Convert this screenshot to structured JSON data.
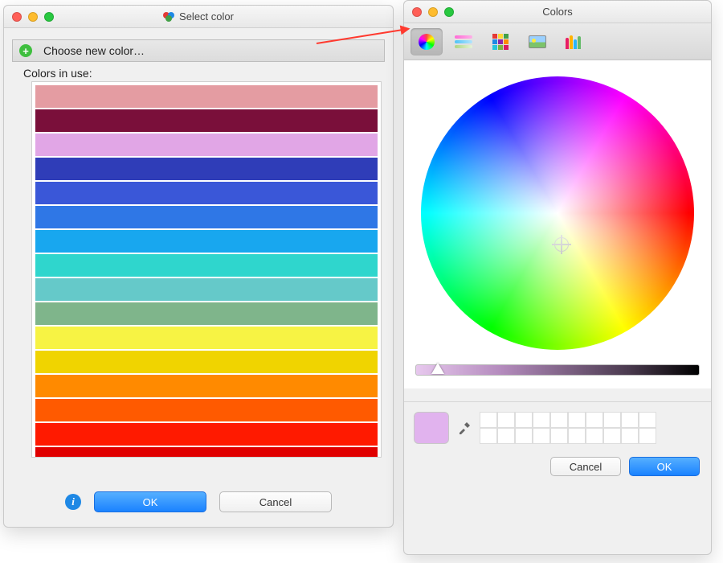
{
  "left_window": {
    "title": "Select color",
    "choose_label": "Choose new color…",
    "in_use_label": "Colors in use:",
    "colors": [
      "#e49ca2",
      "#7a0f3a",
      "#e1a6e6",
      "#2f3db8",
      "#3a57d8",
      "#2f77e6",
      "#18a7ef",
      "#2fd6cd",
      "#65c9c9",
      "#7fb58b",
      "#f7f344",
      "#f0d400",
      "#ff8a00",
      "#ff5a00",
      "#ff1a00",
      "#e00000"
    ],
    "ok_label": "OK",
    "cancel_label": "Cancel"
  },
  "right_window": {
    "title": "Colors",
    "tabs": [
      {
        "name": "wheel",
        "active": true
      },
      {
        "name": "sliders",
        "active": false
      },
      {
        "name": "palette",
        "active": false
      },
      {
        "name": "image",
        "active": false
      },
      {
        "name": "crayons",
        "active": false
      }
    ],
    "current_color": "#e1b3ee",
    "brightness_slider_position": 0.08,
    "swatch_grid_cells": 20,
    "cancel_label": "Cancel",
    "ok_label": "OK"
  }
}
